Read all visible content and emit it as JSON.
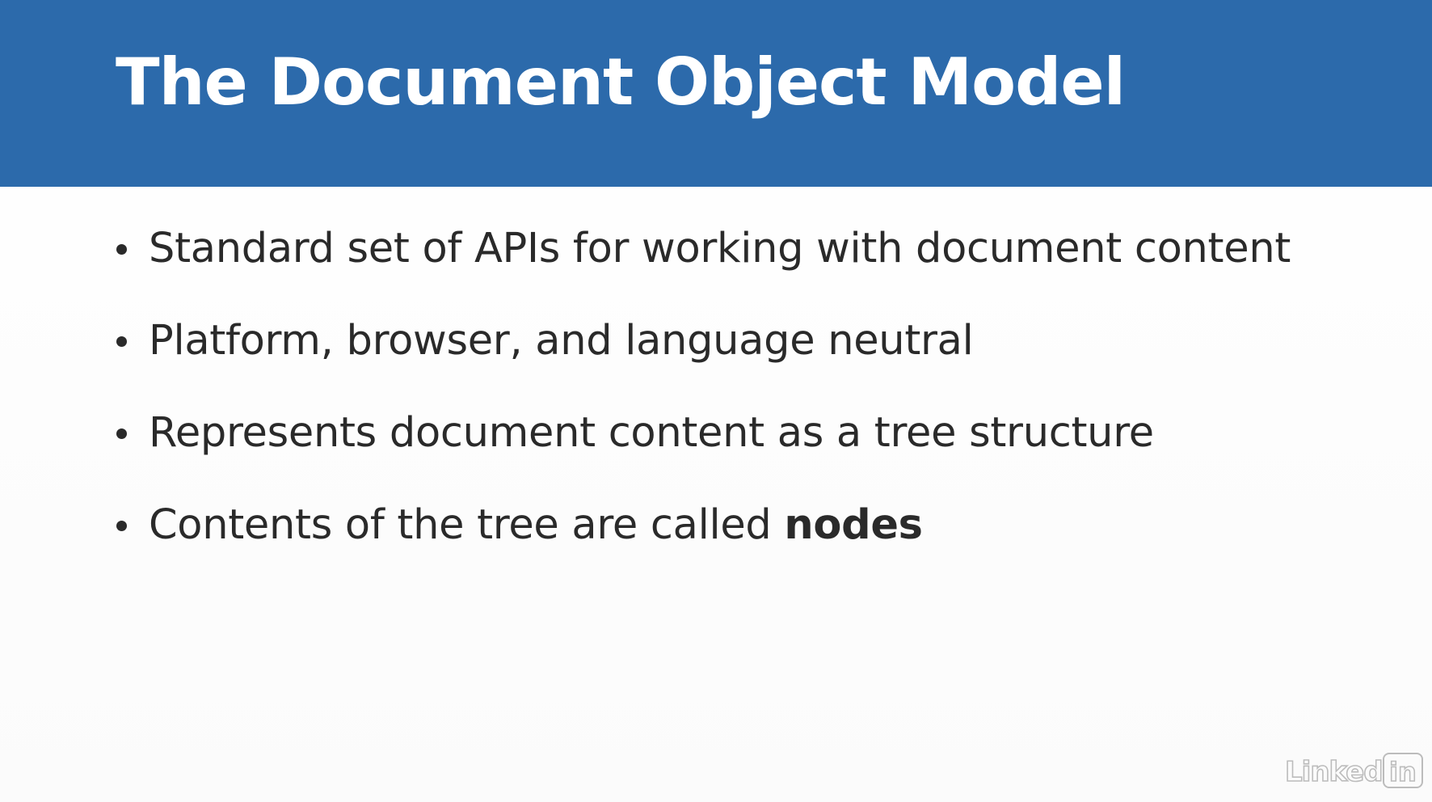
{
  "slide": {
    "title": "The Document Object Model",
    "bullets": [
      {
        "text": "Standard set of APIs for working with document content",
        "emphasis": ""
      },
      {
        "text": "Platform, browser, and language neutral",
        "emphasis": ""
      },
      {
        "text": "Represents document content as a tree structure",
        "emphasis": ""
      },
      {
        "text": "Contents of the tree are called ",
        "emphasis": "nodes"
      }
    ]
  },
  "watermark": {
    "logo_text": "LinkedIn",
    "icon": "linkedin-logo"
  },
  "colors": {
    "title_bar": "#2c6aab",
    "title_text": "#ffffff",
    "body_text": "#2a2a2a",
    "background": "#ffffff"
  }
}
